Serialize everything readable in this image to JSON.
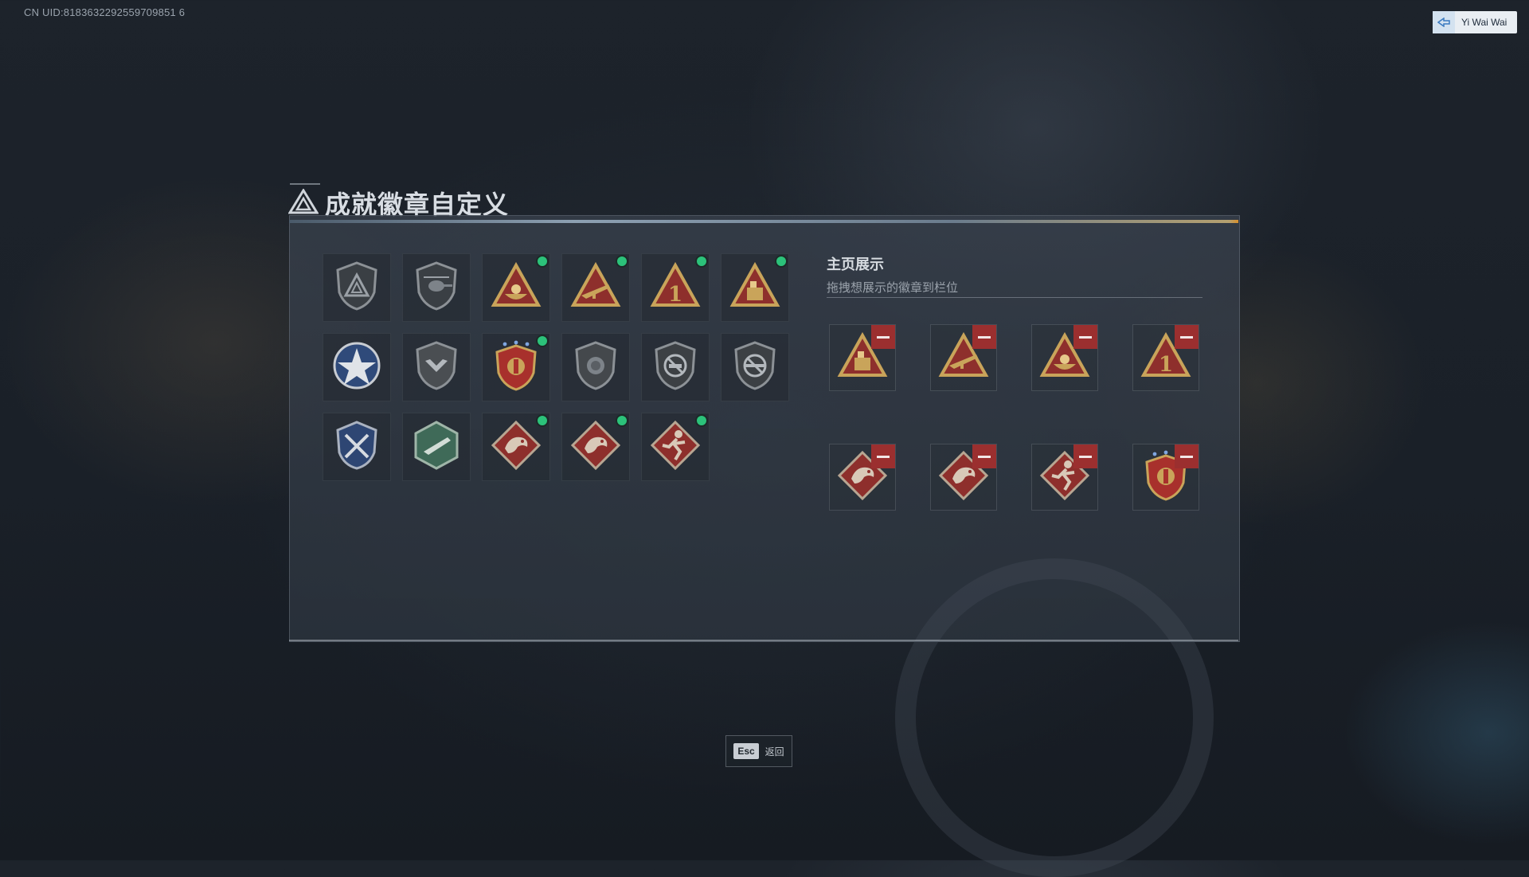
{
  "header": {
    "uid": "CN UID:8183632292559709851 6",
    "user_name": "Yi Wai Wai"
  },
  "page": {
    "title": "成就徽章自定义",
    "esc_key": "Esc",
    "esc_label": "返回"
  },
  "display": {
    "title": "主页展示",
    "subtitle": "拖拽想展示的徽章到栏位"
  },
  "colors": {
    "equipped_dot": "#2cc27a",
    "remove_button": "#9b2f2f",
    "gold": "#c9a45a",
    "red_badge": "#8e2f2c"
  },
  "badges": [
    {
      "icon": "triangle-shield-badge",
      "equipped": false
    },
    {
      "icon": "helicopter-badge",
      "equipped": false
    },
    {
      "icon": "bowl-triangle-badge",
      "equipped": true
    },
    {
      "icon": "rifle-triangle-badge",
      "equipped": true
    },
    {
      "icon": "number-one-triangle-badge",
      "equipped": true
    },
    {
      "icon": "ammo-triangle-badge",
      "equipped": true
    },
    {
      "icon": "star-wreath-badge",
      "equipped": false
    },
    {
      "icon": "eagle-shield-badge",
      "equipped": false
    },
    {
      "icon": "crest-shield-badge",
      "equipped": true
    },
    {
      "icon": "lion-shield-badge",
      "equipped": false
    },
    {
      "icon": "no-pistol-shield-badge",
      "equipped": false
    },
    {
      "icon": "no-rifle-shield-badge",
      "equipped": false
    },
    {
      "icon": "crossed-swords-wreath-badge",
      "equipped": false
    },
    {
      "icon": "gun-hexagon-badge",
      "equipped": false
    },
    {
      "icon": "dragon-diamond-badge",
      "equipped": true
    },
    {
      "icon": "dragon-diamond-badge",
      "equipped": true
    },
    {
      "icon": "runner-diamond-badge",
      "equipped": true
    }
  ],
  "showcase_slots": [
    {
      "icon": "ammo-triangle-badge"
    },
    {
      "icon": "rifle-triangle-badge"
    },
    {
      "icon": "bowl-triangle-badge"
    },
    {
      "icon": "number-one-triangle-badge"
    },
    {
      "icon": "dragon-diamond-badge"
    },
    {
      "icon": "dragon-diamond-badge"
    },
    {
      "icon": "runner-diamond-badge"
    },
    {
      "icon": "crest-shield-badge"
    }
  ]
}
